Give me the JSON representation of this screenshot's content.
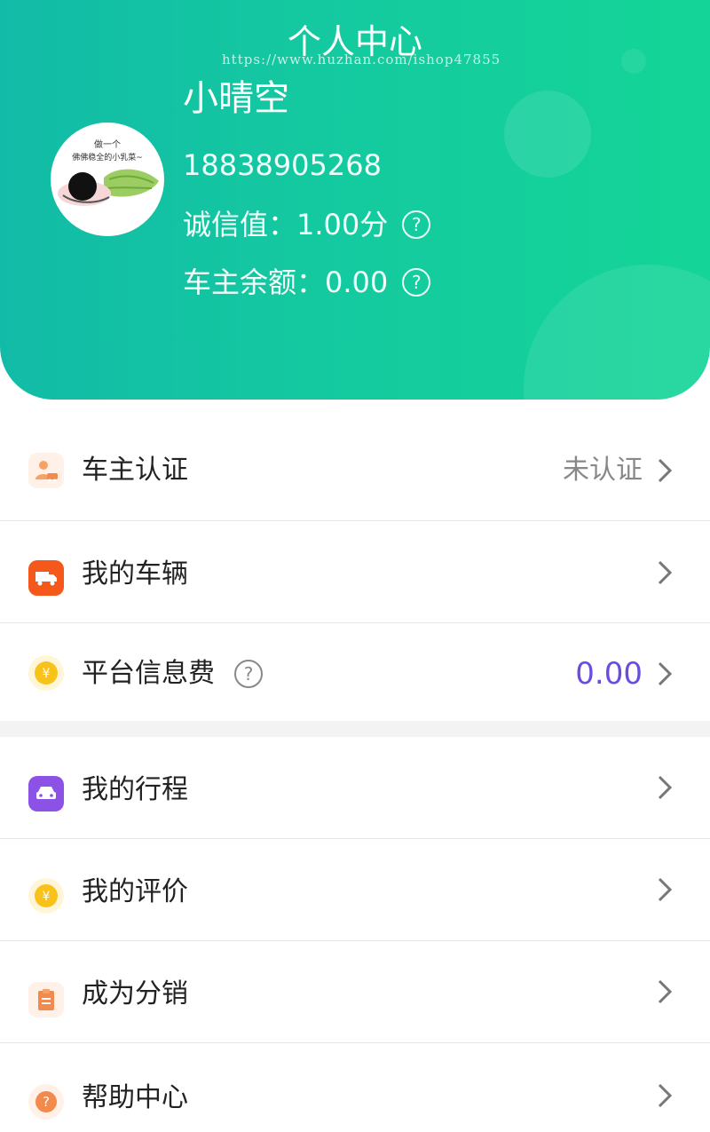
{
  "header": {
    "title": "个人中心",
    "watermark": "https://www.huzhan.com/ishop47855",
    "avatar": {
      "top_text": "做一个",
      "mid_text": "佛佛稳全的小乳菜~"
    },
    "username": "小晴空",
    "phone": "18838905268",
    "credit_label": "诚信值：",
    "credit_value": "1.00分",
    "balance_label": "车主余额：",
    "balance_value": "0.00",
    "help_glyph": "?"
  },
  "menu": {
    "owner_cert": {
      "label": "车主认证",
      "status": "未认证",
      "icon": "person-car-icon",
      "color": "#f6a266"
    },
    "my_vehicles": {
      "label": "我的车辆",
      "icon": "truck-icon",
      "color": "#f4581a"
    },
    "platform_fee": {
      "label": "平台信息费",
      "value": "0.00",
      "icon": "yuan-coin-icon",
      "color": "#f8c21a",
      "value_color": "#6a4ce0"
    },
    "my_trips": {
      "label": "我的行程",
      "icon": "car-icon",
      "color": "#8c52e6"
    },
    "my_reviews": {
      "label": "我的评价",
      "icon": "yuan-coin-icon",
      "color": "#f8c21a"
    },
    "become_distributor": {
      "label": "成为分销",
      "icon": "clipboard-icon",
      "color": "#f28a4d"
    },
    "help_center": {
      "label": "帮助中心",
      "icon": "question-icon",
      "color": "#f28a4d"
    }
  },
  "colors": {
    "header_gradient_start": "#12bba7",
    "header_gradient_end": "#14d597",
    "text_dark": "#222222",
    "text_muted": "#888888"
  }
}
